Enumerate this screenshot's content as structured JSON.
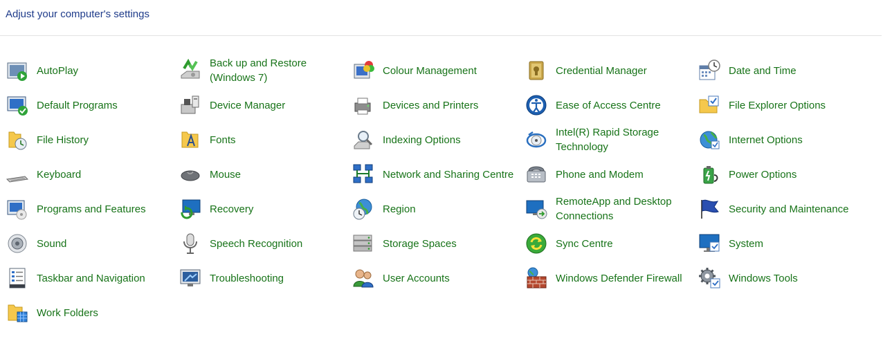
{
  "header": {
    "title": "Adjust your computer's settings"
  },
  "items": [
    {
      "label": "AutoPlay",
      "icon": "autoplay-icon",
      "kind": "autoplay"
    },
    {
      "label": "Back up and Restore (Windows 7)",
      "icon": "backup-restore-icon",
      "kind": "backup"
    },
    {
      "label": "Colour Management",
      "icon": "colour-management-icon",
      "kind": "colour"
    },
    {
      "label": "Credential Manager",
      "icon": "credential-manager-icon",
      "kind": "credential"
    },
    {
      "label": "Date and Time",
      "icon": "date-time-icon",
      "kind": "datetime"
    },
    {
      "label": "Default Programs",
      "icon": "default-programs-icon",
      "kind": "defaultprog"
    },
    {
      "label": "Device Manager",
      "icon": "device-manager-icon",
      "kind": "devicemgr"
    },
    {
      "label": "Devices and Printers",
      "icon": "devices-printers-icon",
      "kind": "printer"
    },
    {
      "label": "Ease of Access Centre",
      "icon": "ease-of-access-icon",
      "kind": "ease"
    },
    {
      "label": "File Explorer Options",
      "icon": "file-explorer-options-icon",
      "kind": "folderopt"
    },
    {
      "label": "File History",
      "icon": "file-history-icon",
      "kind": "filehistory"
    },
    {
      "label": "Fonts",
      "icon": "fonts-icon",
      "kind": "fonts"
    },
    {
      "label": "Indexing Options",
      "icon": "indexing-options-icon",
      "kind": "indexing"
    },
    {
      "label": "Intel(R) Rapid Storage Technology",
      "icon": "intel-rapid-storage-icon",
      "kind": "intel"
    },
    {
      "label": "Internet Options",
      "icon": "internet-options-icon",
      "kind": "internet"
    },
    {
      "label": "Keyboard",
      "icon": "keyboard-icon",
      "kind": "keyboard"
    },
    {
      "label": "Mouse",
      "icon": "mouse-icon",
      "kind": "mouse"
    },
    {
      "label": "Network and Sharing Centre",
      "icon": "network-sharing-icon",
      "kind": "network"
    },
    {
      "label": "Phone and Modem",
      "icon": "phone-modem-icon",
      "kind": "phone"
    },
    {
      "label": "Power Options",
      "icon": "power-options-icon",
      "kind": "power"
    },
    {
      "label": "Programs and Features",
      "icon": "programs-features-icon",
      "kind": "programs"
    },
    {
      "label": "Recovery",
      "icon": "recovery-icon",
      "kind": "recovery"
    },
    {
      "label": "Region",
      "icon": "region-icon",
      "kind": "region"
    },
    {
      "label": "RemoteApp and Desktop Connections",
      "icon": "remoteapp-icon",
      "kind": "remoteapp"
    },
    {
      "label": "Security and Maintenance",
      "icon": "security-maintenance-icon",
      "kind": "security"
    },
    {
      "label": "Sound",
      "icon": "sound-icon",
      "kind": "sound"
    },
    {
      "label": "Speech Recognition",
      "icon": "speech-recognition-icon",
      "kind": "speech"
    },
    {
      "label": "Storage Spaces",
      "icon": "storage-spaces-icon",
      "kind": "storage"
    },
    {
      "label": "Sync Centre",
      "icon": "sync-centre-icon",
      "kind": "sync"
    },
    {
      "label": "System",
      "icon": "system-icon",
      "kind": "system"
    },
    {
      "label": "Taskbar and Navigation",
      "icon": "taskbar-navigation-icon",
      "kind": "taskbar"
    },
    {
      "label": "Troubleshooting",
      "icon": "troubleshooting-icon",
      "kind": "troubleshoot"
    },
    {
      "label": "User Accounts",
      "icon": "user-accounts-icon",
      "kind": "users"
    },
    {
      "label": "Windows Defender Firewall",
      "icon": "firewall-icon",
      "kind": "firewall"
    },
    {
      "label": "Windows Tools",
      "icon": "windows-tools-icon",
      "kind": "tools"
    },
    {
      "label": "Work Folders",
      "icon": "work-folders-icon",
      "kind": "workfolders"
    }
  ],
  "colors": {
    "title": "#1e3b8a",
    "link": "#177318",
    "divider": "#e3e3e3"
  }
}
